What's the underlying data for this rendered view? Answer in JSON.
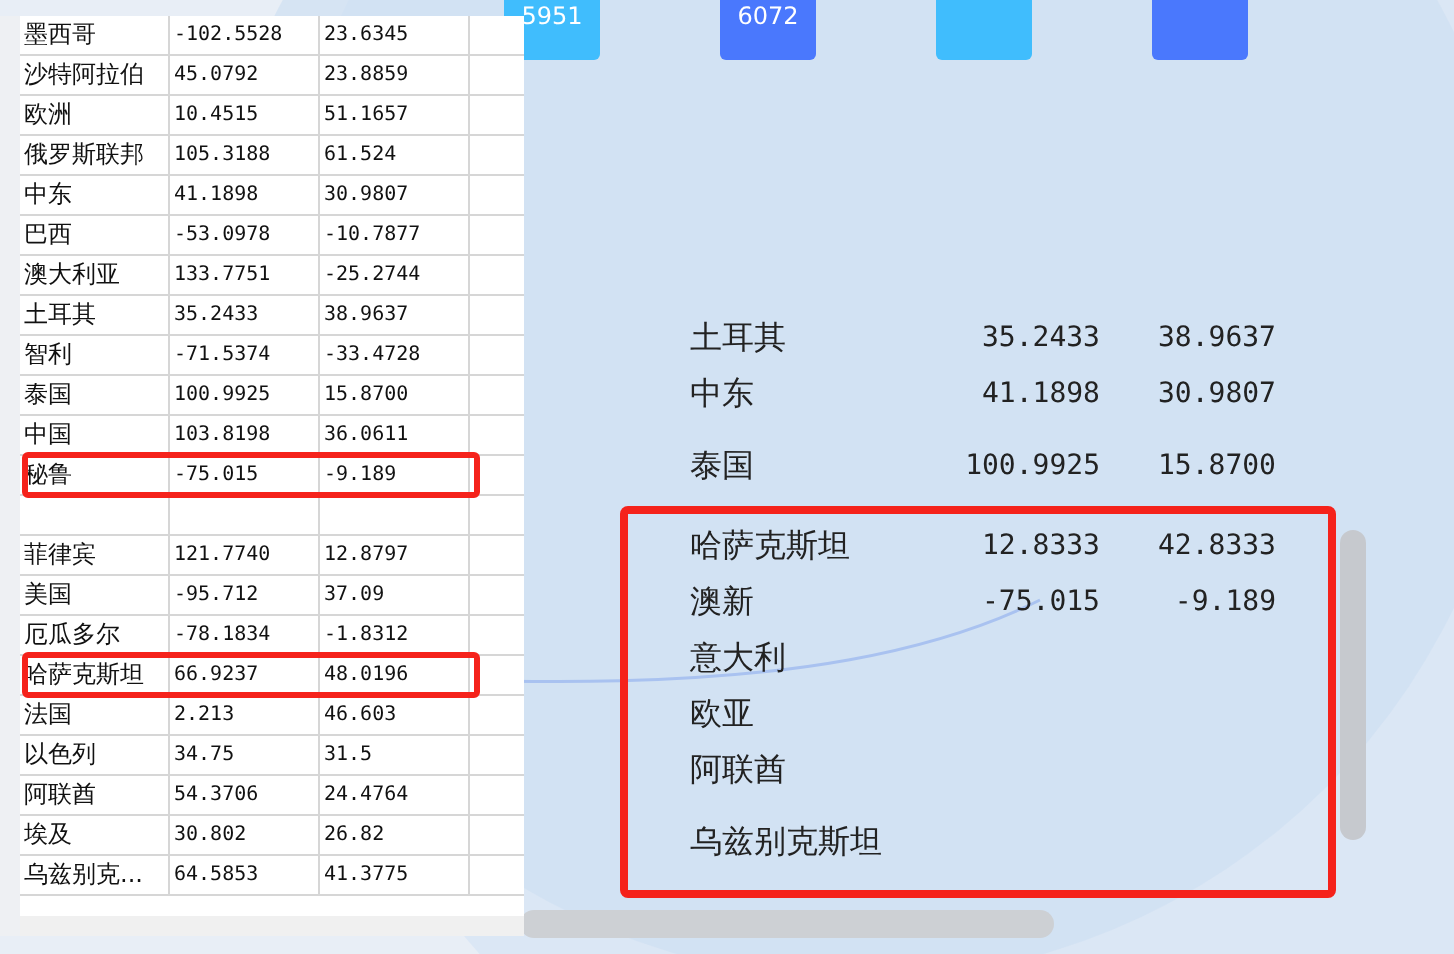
{
  "tiles": [
    {
      "label": "5951",
      "color": "#40bdfd"
    },
    {
      "label": "6072",
      "color": "#4a78fd"
    },
    {
      "color": "#40bdfd"
    },
    {
      "color": "#4a78fd"
    }
  ],
  "table": {
    "rows": [
      {
        "kind": "data",
        "name": "墨西哥",
        "lng": "-102.5528",
        "lat": "23.6345",
        "highlighted": false
      },
      {
        "kind": "data",
        "name": "沙特阿拉伯",
        "lng": "45.0792",
        "lat": "23.8859",
        "highlighted": false
      },
      {
        "kind": "data",
        "name": "欧洲",
        "lng": "10.4515",
        "lat": "51.1657",
        "highlighted": false
      },
      {
        "kind": "data",
        "name": "俄罗斯联邦",
        "lng": "105.3188",
        "lat": "61.524",
        "highlighted": false
      },
      {
        "kind": "data",
        "name": "中东",
        "lng": "41.1898",
        "lat": "30.9807",
        "highlighted": false
      },
      {
        "kind": "data",
        "name": "巴西",
        "lng": "-53.0978",
        "lat": "-10.7877",
        "highlighted": false
      },
      {
        "kind": "data",
        "name": "澳大利亚",
        "lng": "133.7751",
        "lat": "-25.2744",
        "highlighted": false
      },
      {
        "kind": "data",
        "name": "土耳其",
        "lng": "35.2433",
        "lat": "38.9637",
        "highlighted": false
      },
      {
        "kind": "data",
        "name": "智利",
        "lng": "-71.5374",
        "lat": "-33.4728",
        "highlighted": false
      },
      {
        "kind": "data",
        "name": "泰国",
        "lng": "100.9925",
        "lat": "15.8700",
        "highlighted": false
      },
      {
        "kind": "data",
        "name": "中国",
        "lng": "103.8198",
        "lat": "36.0611",
        "highlighted": false
      },
      {
        "kind": "data",
        "name": "秘鲁",
        "lng": "-75.015",
        "lat": "-9.189",
        "highlighted": true
      },
      {
        "kind": "obscured",
        "highlighted": false
      },
      {
        "kind": "data",
        "name": "菲律宾",
        "lng": "121.7740",
        "lat": "12.8797",
        "highlighted": false
      },
      {
        "kind": "data",
        "name": "美国",
        "lng": "-95.712",
        "lat": "37.09",
        "highlighted": false
      },
      {
        "kind": "data",
        "name": "厄瓜多尔",
        "lng": "-78.1834",
        "lat": "-1.8312",
        "highlighted": false
      },
      {
        "kind": "data",
        "name": "哈萨克斯坦",
        "lng": "66.9237",
        "lat": "48.0196",
        "highlighted": true
      },
      {
        "kind": "data",
        "name": "法国",
        "lng": "2.213",
        "lat": "46.603",
        "highlighted": false
      },
      {
        "kind": "data",
        "name": "以色列",
        "lng": "34.75",
        "lat": "31.5",
        "highlighted": false
      },
      {
        "kind": "data",
        "name": "阿联酋",
        "lng": "54.3706",
        "lat": "24.4764",
        "highlighted": false
      },
      {
        "kind": "data",
        "name": "埃及",
        "lng": "30.802",
        "lat": "26.82",
        "highlighted": false
      },
      {
        "kind": "data",
        "name": "乌兹别克...",
        "lng": "64.5853",
        "lat": "41.3775",
        "highlighted": false
      }
    ]
  },
  "panel": {
    "rows": [
      {
        "name": "土耳其",
        "lng": "35.2433",
        "lat": "38.9637"
      },
      {
        "name": "中东",
        "lng": "41.1898",
        "lat": "30.9807"
      },
      {
        "name": "泰国",
        "lng": "100.9925",
        "lat": "15.8700"
      }
    ],
    "frame": {
      "highlighted": true,
      "rows": [
        {
          "name": "哈萨克斯坦",
          "lng": "12.8333",
          "lat": "42.8333"
        },
        {
          "name": "澳新",
          "lng": "-75.015",
          "lat": "-9.189"
        },
        {
          "name": "意大利"
        },
        {
          "name": "欧亚"
        },
        {
          "name": "阿联酋"
        },
        {
          "name": "乌兹别克斯坦"
        }
      ]
    }
  }
}
